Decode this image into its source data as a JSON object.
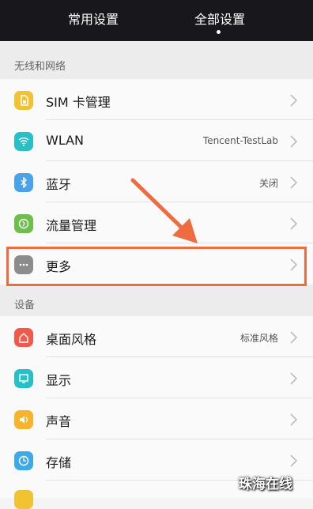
{
  "tabs": {
    "common": "常用设置",
    "all": "全部设置"
  },
  "sections": {
    "network": "无线和网络",
    "device": "设备"
  },
  "rows": [
    {
      "label": "SIM 卡管理",
      "value": "",
      "icon": "sim-card-icon",
      "color": "#f1c232"
    },
    {
      "label": "WLAN",
      "value": "Tencent-TestLab",
      "icon": "wifi-icon",
      "color": "#29bfc6"
    },
    {
      "label": "蓝牙",
      "value": "关闭",
      "icon": "bluetooth-icon",
      "color": "#4aa3e8"
    },
    {
      "label": "流量管理",
      "value": "",
      "icon": "data-usage-icon",
      "color": "#6cc04a"
    },
    {
      "label": "更多",
      "value": "",
      "icon": "more-dots-icon",
      "color": "#8c8c8c"
    },
    {
      "label": "桌面风格",
      "value": "标准风格",
      "icon": "home-style-icon",
      "color": "#ef5a4a"
    },
    {
      "label": "显示",
      "value": "",
      "icon": "display-icon",
      "color": "#29bfc6"
    },
    {
      "label": "声音",
      "value": "",
      "icon": "sound-icon",
      "color": "#f6b42b"
    },
    {
      "label": "存储",
      "value": "",
      "icon": "storage-icon",
      "color": "#3fa9e8"
    }
  ],
  "accent": "#ee6c3f",
  "watermark": "珠海在线"
}
